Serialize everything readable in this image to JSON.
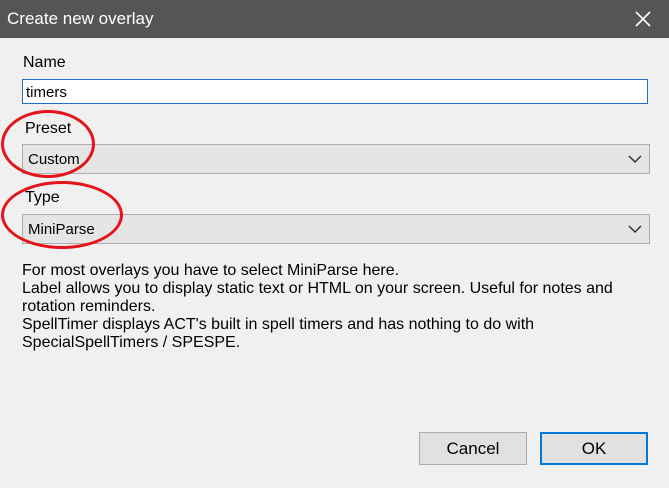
{
  "window": {
    "title": "Create new overlay",
    "close_icon": "close-icon"
  },
  "form": {
    "name_label": "Name",
    "name_value": "timers",
    "preset_label": "Preset",
    "preset_value": "Custom",
    "type_label": "Type",
    "type_value": "MiniParse"
  },
  "help_lines": [
    "For most overlays you have to select MiniParse here.",
    "Label allows you to display static text or HTML on your screen. Useful for notes and",
    "rotation reminders.",
    "SpellTimer displays ACT's built in spell timers and has nothing to do with",
    "SpecialSpellTimers / SPESPE."
  ],
  "buttons": {
    "cancel": "Cancel",
    "ok": "OK"
  },
  "colors": {
    "titlebar": "#555555",
    "annotation_circle": "#e4141b",
    "accent": "#0078d7"
  }
}
